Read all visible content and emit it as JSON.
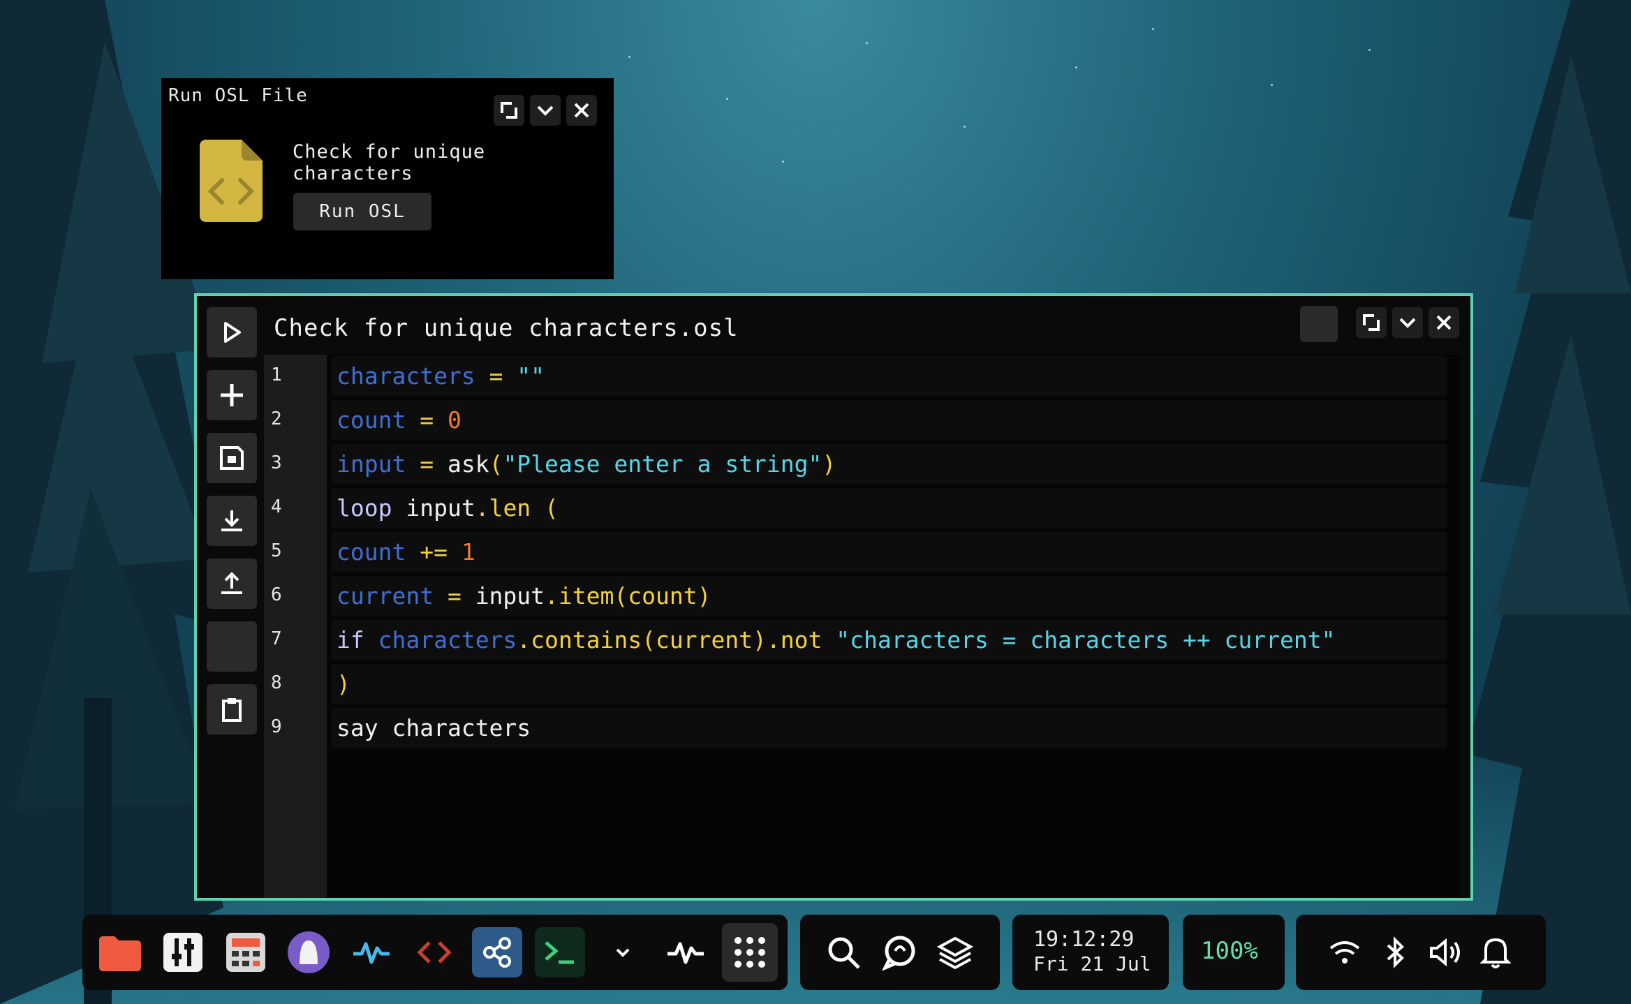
{
  "popup": {
    "title": "Run OSL File",
    "message": "Check for unique characters",
    "run_label": "Run OSL"
  },
  "editor": {
    "title": "Check for unique characters.osl",
    "line_numbers": [
      "1",
      "2",
      "3",
      "4",
      "5",
      "6",
      "7",
      "8",
      "9"
    ],
    "lines": [
      [
        {
          "t": "characters",
          "c": "var"
        },
        {
          "t": " = ",
          "c": "op"
        },
        {
          "t": "\"\"",
          "c": "str"
        }
      ],
      [
        {
          "t": "count",
          "c": "var"
        },
        {
          "t": " = ",
          "c": "op"
        },
        {
          "t": "0",
          "c": "num"
        }
      ],
      [
        {
          "t": "input",
          "c": "var"
        },
        {
          "t": " = ",
          "c": "op"
        },
        {
          "t": "ask",
          "c": "plain"
        },
        {
          "t": "(",
          "c": "paren"
        },
        {
          "t": "\"Please enter a string\"",
          "c": "str"
        },
        {
          "t": ")",
          "c": "paren"
        }
      ],
      [
        {
          "t": "loop",
          "c": "kw"
        },
        {
          "t": " input",
          "c": "plain"
        },
        {
          "t": ".len",
          "c": "fn"
        },
        {
          "t": " (",
          "c": "paren"
        }
      ],
      [
        {
          "t": "count",
          "c": "var"
        },
        {
          "t": " += ",
          "c": "op"
        },
        {
          "t": "1",
          "c": "num"
        }
      ],
      [
        {
          "t": "current",
          "c": "var"
        },
        {
          "t": " = ",
          "c": "op"
        },
        {
          "t": "input",
          "c": "plain"
        },
        {
          "t": ".item(count)",
          "c": "fn"
        }
      ],
      [
        {
          "t": "if",
          "c": "kw"
        },
        {
          "t": " characters",
          "c": "var"
        },
        {
          "t": ".contains(current).not",
          "c": "fn"
        },
        {
          "t": " \"characters = characters ++ current\"",
          "c": "str"
        }
      ],
      [
        {
          "t": ")",
          "c": "paren"
        }
      ],
      [
        {
          "t": "say characters",
          "c": "plain"
        }
      ]
    ]
  },
  "taskbar": {
    "time": "19:12:29",
    "date": "Fri 21 Jul",
    "battery": "100%"
  },
  "colors": {
    "accent": "#5fd3b0",
    "variable": "#3f6fd0",
    "operator": "#f4d03f",
    "number": "#f27a2a",
    "string": "#58d4e8"
  }
}
